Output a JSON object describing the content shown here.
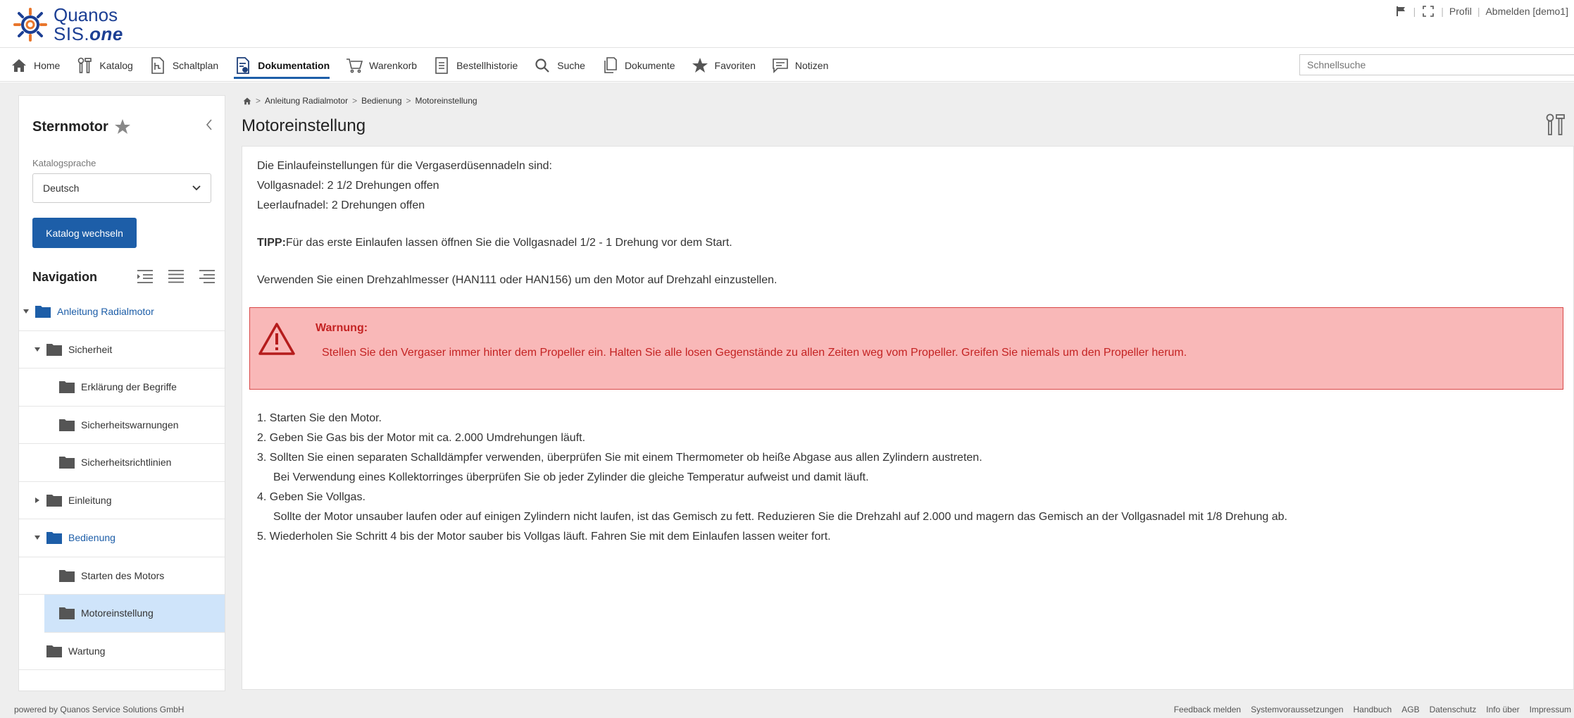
{
  "brand": {
    "line1": "Quanos",
    "line2_prefix": "SIS.",
    "line2_suffix": "one"
  },
  "top_links": {
    "profile": "Profil",
    "logout": "Abmelden [demo1]"
  },
  "nav": {
    "items": [
      {
        "label": "Home",
        "icon": "home-icon"
      },
      {
        "label": "Katalog",
        "icon": "tools-icon"
      },
      {
        "label": "Schaltplan",
        "icon": "schematic-icon"
      },
      {
        "label": "Dokumentation",
        "icon": "documentation-icon",
        "active": true
      },
      {
        "label": "Warenkorb",
        "icon": "cart-icon"
      },
      {
        "label": "Bestellhistorie",
        "icon": "order-history-icon"
      },
      {
        "label": "Suche",
        "icon": "search-icon"
      },
      {
        "label": "Dokumente",
        "icon": "documents-icon"
      },
      {
        "label": "Favoriten",
        "icon": "star-icon"
      },
      {
        "label": "Notizen",
        "icon": "notes-icon"
      }
    ],
    "quicksearch_placeholder": "Schnellsuche"
  },
  "sidebar": {
    "title": "Sternmotor",
    "language_label": "Katalogsprache",
    "language_value": "Deutsch",
    "switch_button": "Katalog wechseln",
    "navigation_label": "Navigation",
    "tree": [
      {
        "label": "Anleitung Radialmotor",
        "level": 0,
        "expanded": true,
        "blue": true
      },
      {
        "label": "Sicherheit",
        "level": 1,
        "expanded": true
      },
      {
        "label": "Erklärung der Begriffe",
        "level": 2
      },
      {
        "label": "Sicherheitswarnungen",
        "level": 2
      },
      {
        "label": "Sicherheitsrichtlinien",
        "level": 2
      },
      {
        "label": "Einleitung",
        "level": 1,
        "expanded": false
      },
      {
        "label": "Bedienung",
        "level": 1,
        "expanded": true,
        "blue": true
      },
      {
        "label": "Starten des Motors",
        "level": 2
      },
      {
        "label": "Motoreinstellung",
        "level": 2,
        "selected": true
      },
      {
        "label": "Wartung",
        "level": 1
      }
    ]
  },
  "breadcrumb": [
    "Anleitung Radialmotor",
    "Bedienung",
    "Motoreinstellung"
  ],
  "page_title": "Motoreinstellung",
  "content": {
    "intro1": "Die Einlaufeinstellungen für die Vergaserdüsennadeln sind:",
    "intro2": "Vollgasnadel: 2 1/2 Drehungen offen",
    "intro3": "Leerlaufnadel: 2 Drehungen offen",
    "tip_label": "TIPP:",
    "tip_text": "Für das erste Einlaufen lassen öffnen Sie die Vollgasnadel 1/2 - 1 Drehung vor dem Start.",
    "tacho": "Verwenden Sie einen Drehzahlmesser (HAN111 oder HAN156) um den Motor auf Drehzahl einzustellen.",
    "warning_title": "Warnung:",
    "warning_text": "Stellen Sie den Vergaser immer hinter dem Propeller ein. Halten Sie alle losen Gegenstände zu allen Zeiten weg vom Propeller. Greifen Sie niemals um den Propeller herum.",
    "steps": [
      "1. Starten Sie den Motor.",
      "2. Geben Sie Gas bis der Motor mit ca. 2.000 Umdrehungen läuft.",
      "3. Sollten Sie einen separaten Schalldämpfer verwenden, überprüfen Sie mit einem Thermometer ob heiße Abgase aus allen Zylindern austreten.",
      "Bei Verwendung eines Kollektorringes überprüfen Sie ob jeder Zylinder die gleiche Temperatur aufweist und damit läuft.",
      "4. Geben Sie Vollgas.",
      "Sollte der Motor unsauber laufen oder auf einigen Zylindern nicht laufen, ist das Gemisch zu fett. Reduzieren Sie die Drehzahl auf 2.000 und magern das Gemisch an der Vollgasnadel mit 1/8 Drehung ab.",
      "5. Wiederholen Sie Schritt 4 bis der Motor sauber bis Vollgas läuft. Fahren Sie mit dem Einlaufen lassen weiter fort."
    ]
  },
  "footer": {
    "left": "powered by Quanos Service Solutions GmbH",
    "links": [
      "Feedback melden",
      "Systemvoraussetzungen",
      "Handbuch",
      "AGB",
      "Datenschutz",
      "Info über",
      "Impressum"
    ]
  },
  "colors": {
    "accent": "#1d5ea8",
    "warning_bg": "#f9b8b8",
    "warning_text": "#c42323",
    "selected_row": "#cfe4fa"
  }
}
